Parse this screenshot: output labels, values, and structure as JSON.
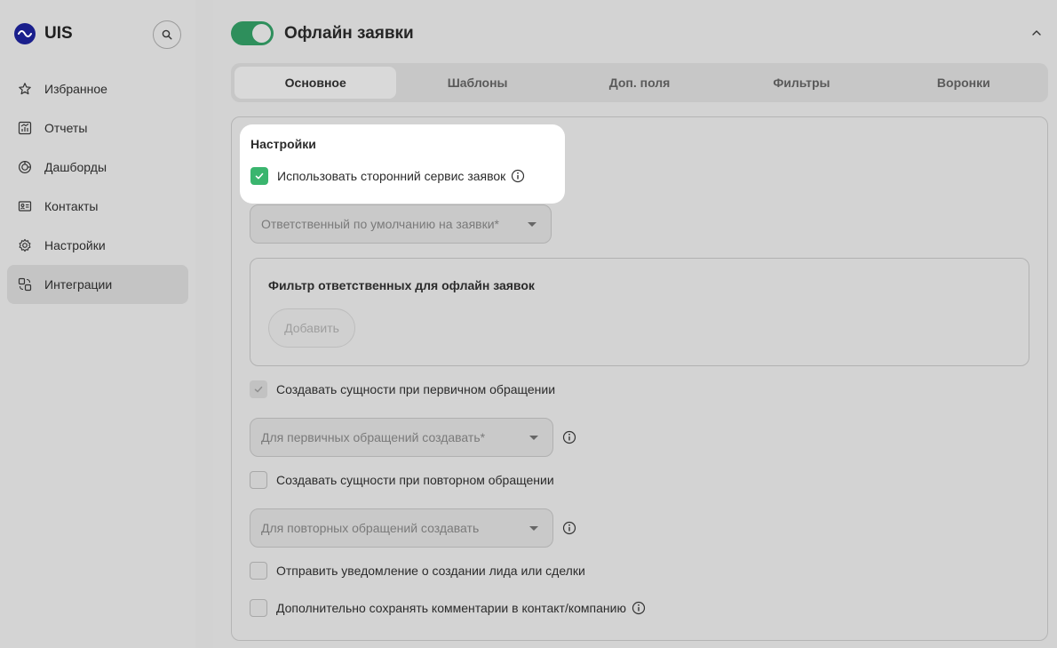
{
  "brand": {
    "name": "UIS",
    "color": "#1a1f8c"
  },
  "sidebar": {
    "search_icon": "search-icon",
    "items": [
      {
        "label": "Избранное",
        "icon": "star-icon",
        "active": false
      },
      {
        "label": "Отчеты",
        "icon": "chart-icon",
        "active": false
      },
      {
        "label": "Дашборды",
        "icon": "dashboard-icon",
        "active": false
      },
      {
        "label": "Контакты",
        "icon": "contact-card-icon",
        "active": false
      },
      {
        "label": "Настройки",
        "icon": "gear-icon",
        "active": false
      },
      {
        "label": "Интеграции",
        "icon": "integrations-icon",
        "active": true
      }
    ]
  },
  "header": {
    "title": "Офлайн заявки",
    "toggle_on": true,
    "toggle_color": "#2e8f5c"
  },
  "tabs": [
    {
      "label": "Основное",
      "active": true
    },
    {
      "label": "Шаблоны",
      "active": false
    },
    {
      "label": "Доп. поля",
      "active": false
    },
    {
      "label": "Фильтры",
      "active": false
    },
    {
      "label": "Воронки",
      "active": false
    }
  ],
  "settings": {
    "section_title": "Настройки",
    "use_third_party": {
      "label": "Использовать сторонний сервис заявок",
      "checked": true,
      "checked_color": "#3ab56e"
    },
    "default_responsible": {
      "placeholder": "Ответственный по умолчанию на заявки*"
    },
    "filter": {
      "title": "Фильтр ответственных для офлайн заявок",
      "add_label": "Добавить"
    },
    "create_on_first": {
      "label": "Создавать сущности при первичном обращении",
      "checked": true
    },
    "first_select": {
      "placeholder": "Для первичных обращений создавать*"
    },
    "create_on_repeat": {
      "label": "Создавать сущности при повторном обращении",
      "checked": false
    },
    "repeat_select": {
      "placeholder": "Для повторных обращений создавать"
    },
    "notify": {
      "label": "Отправить уведомление о создании лида или сделки",
      "checked": false
    },
    "save_comments": {
      "label": "Дополнительно сохранять комментарии в контакт/компанию",
      "checked": false
    }
  }
}
